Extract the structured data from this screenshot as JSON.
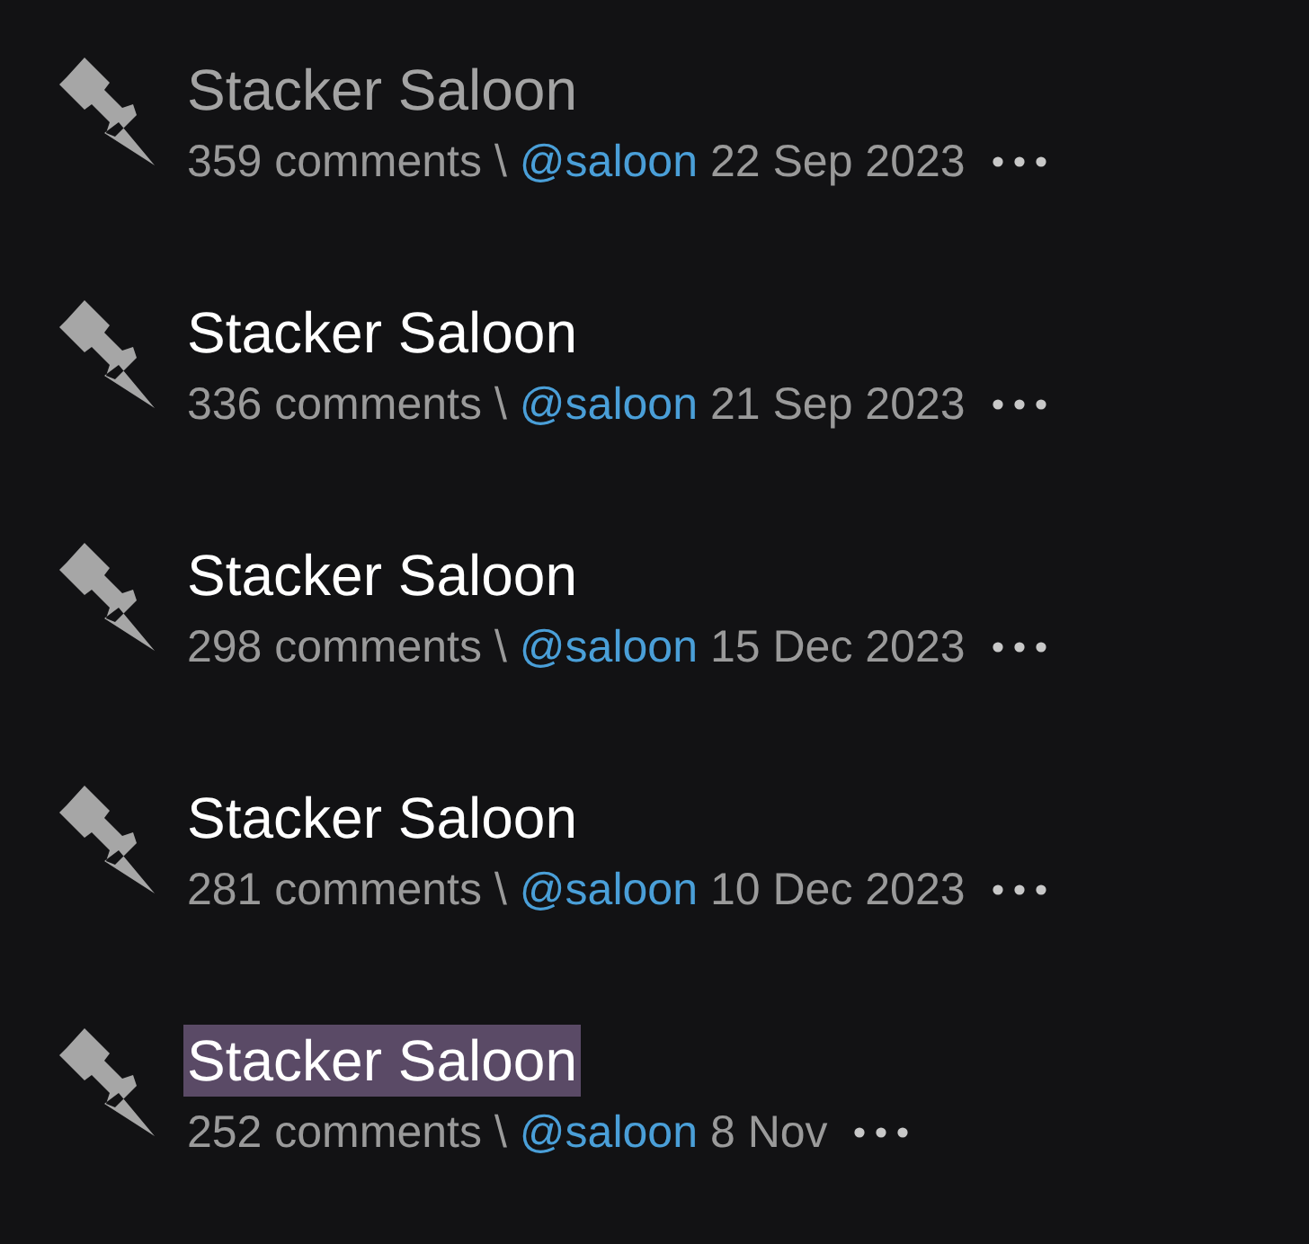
{
  "posts": [
    {
      "title": "Stacker Saloon",
      "visited": true,
      "highlighted": false,
      "comments": "359 comments",
      "separator": "\\",
      "author": "@saloon",
      "date": "22 Sep 2023"
    },
    {
      "title": "Stacker Saloon",
      "visited": false,
      "highlighted": false,
      "comments": "336 comments",
      "separator": "\\",
      "author": "@saloon",
      "date": "21 Sep 2023"
    },
    {
      "title": "Stacker Saloon",
      "visited": false,
      "highlighted": false,
      "comments": "298 comments",
      "separator": "\\",
      "author": "@saloon",
      "date": "15 Dec 2023"
    },
    {
      "title": "Stacker Saloon",
      "visited": false,
      "highlighted": false,
      "comments": "281 comments",
      "separator": "\\",
      "author": "@saloon",
      "date": "10 Dec 2023"
    },
    {
      "title": "Stacker Saloon",
      "visited": false,
      "highlighted": true,
      "comments": "252 comments",
      "separator": "\\",
      "author": "@saloon",
      "date": "8 Nov"
    }
  ]
}
